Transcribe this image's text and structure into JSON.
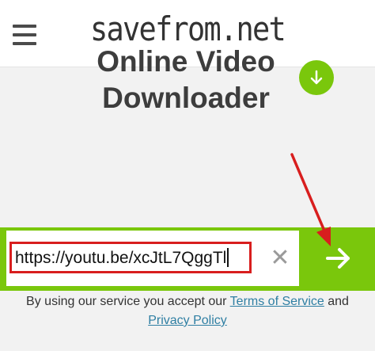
{
  "header": {
    "logo_text": "savefrom.net",
    "menu_icon": "hamburger-menu-icon"
  },
  "main": {
    "title_line1": "Online Video",
    "title_line2": "Downloader",
    "download_badge_icon": "download-arrow-icon"
  },
  "search": {
    "url_value": "https://youtu.be/xcJtL7QggTl",
    "clear_icon": "close-icon",
    "clear_glyph": "✕",
    "submit_icon": "arrow-right-icon"
  },
  "terms": {
    "prefix": "By using our service you accept our ",
    "terms_link": "Terms of Service",
    "conjunction": " and",
    "privacy_link": "Privacy Policy"
  },
  "colors": {
    "accent_green": "#7ac70c",
    "annotation_red": "#d81e1e",
    "link_blue": "#2f7fa3"
  }
}
